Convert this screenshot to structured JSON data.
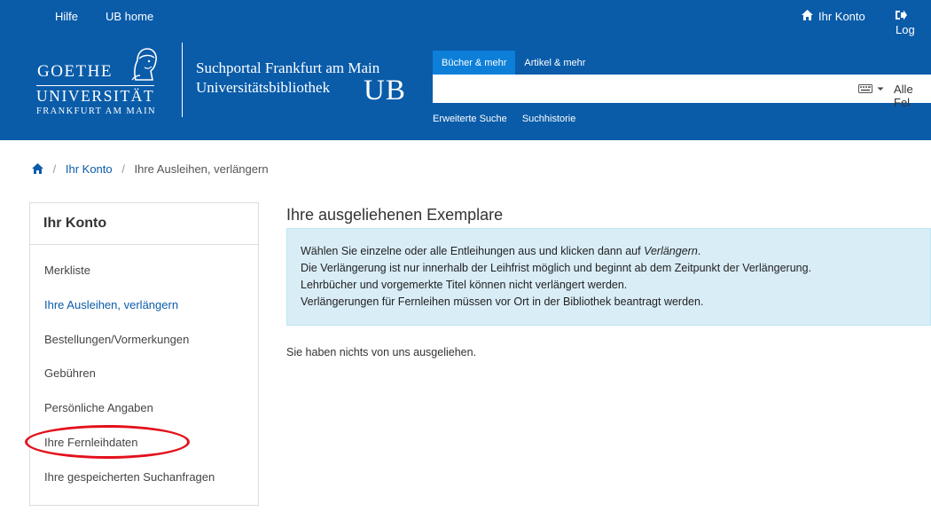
{
  "top_nav": {
    "help": "Hilfe",
    "ub_home": "UB home",
    "account": "Ihr Konto",
    "logout": "Log"
  },
  "logo": {
    "line1": "GOETHE",
    "line2": "UNIVERSITÄT",
    "line3": "FRANKFURT AM MAIN"
  },
  "portal": {
    "title_line1": "Suchportal Frankfurt am Main",
    "title_line2": "Universitätsbibliothek",
    "ub": "UB"
  },
  "search": {
    "tabs": [
      {
        "label": "Bücher & mehr",
        "active": true
      },
      {
        "label": "Artikel & mehr",
        "active": false
      }
    ],
    "value": "",
    "scope": "Alle Fel",
    "links": [
      "Erweiterte Suche",
      "Suchhistorie"
    ]
  },
  "breadcrumb": {
    "items": [
      "Ihr Konto",
      "Ihre Ausleihen, verlängern"
    ]
  },
  "sidebar": {
    "title": "Ihr Konto",
    "items": [
      {
        "label": "Merkliste",
        "active": false
      },
      {
        "label": "Ihre Ausleihen, verlängern",
        "active": true
      },
      {
        "label": "Bestellungen/Vormerkungen",
        "active": false
      },
      {
        "label": "Gebühren",
        "active": false
      },
      {
        "label": "Persönliche Angaben",
        "active": false
      },
      {
        "label": "Ihre Fernleihdaten",
        "active": false
      },
      {
        "label": "Ihre gespeicherten Suchanfragen",
        "active": false
      }
    ]
  },
  "main": {
    "heading": "Ihre ausgeliehenen Exemplare",
    "info_line1_prefix": "Wählen Sie einzelne oder alle Entleihungen aus und klicken dann auf ",
    "info_line1_em": "Verlängern",
    "info_line1_suffix": ".",
    "info_lines": [
      "Die Verlängerung ist nur innerhalb der Leihfrist möglich und beginnt ab dem Zeitpunkt der Verlängerung.",
      "Lehrbücher und vorgemerkte Titel können nicht verlängert werden.",
      "Verlängerungen für Fernleihen müssen vor Ort in der Bibliothek beantragt werden."
    ],
    "empty_message": "Sie haben nichts von uns ausgeliehen."
  },
  "colors": {
    "header_bg": "#0a5ca9",
    "active_tab": "#0d7fd8",
    "link": "#0a5ca9",
    "info_bg": "#d9edf7",
    "annotation": "#e3101b"
  }
}
